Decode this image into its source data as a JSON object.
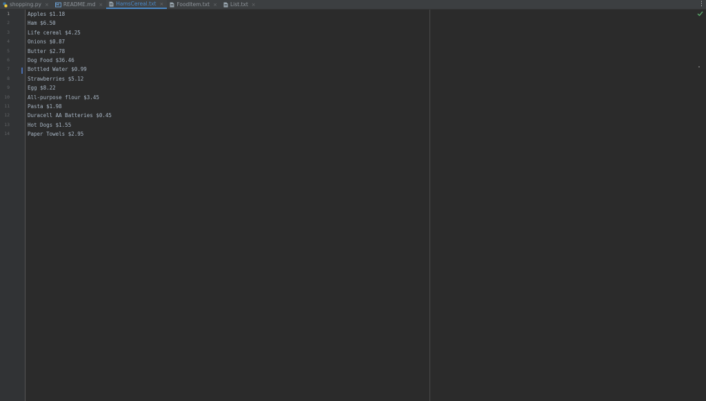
{
  "tabs": [
    {
      "label": "shopping.py",
      "icon": "python-file-icon",
      "active": false
    },
    {
      "label": "README.md",
      "icon": "markdown-file-icon",
      "active": false
    },
    {
      "label": "HamsCereal.txt",
      "icon": "text-file-icon",
      "active": true
    },
    {
      "label": "FoodItem.txt",
      "icon": "text-file-icon",
      "active": false
    },
    {
      "label": "List.txt",
      "icon": "text-file-icon",
      "active": false
    }
  ],
  "editor": {
    "lines": [
      "Apples $1.18",
      "Ham $6.50",
      "Life cereal $4.25",
      "Onions $0.87",
      "Butter $2.78",
      "Dog Food $36.46",
      "Bottled Water $0.99",
      "Strawberries $5.12",
      "Egg $8.22",
      "All-purpose flour $3.45",
      "Pasta $1.98",
      "Duracell AA Batteries $0.45",
      "Hot Dogs $1.55",
      "Paper Towels $2.95"
    ],
    "line_numbers": [
      "1",
      "2",
      "3",
      "4",
      "5",
      "6",
      "7",
      "8",
      "9",
      "10",
      "11",
      "12",
      "13",
      "14"
    ]
  },
  "colors": {
    "accent": "#4a88c7",
    "check": "#59a869"
  }
}
